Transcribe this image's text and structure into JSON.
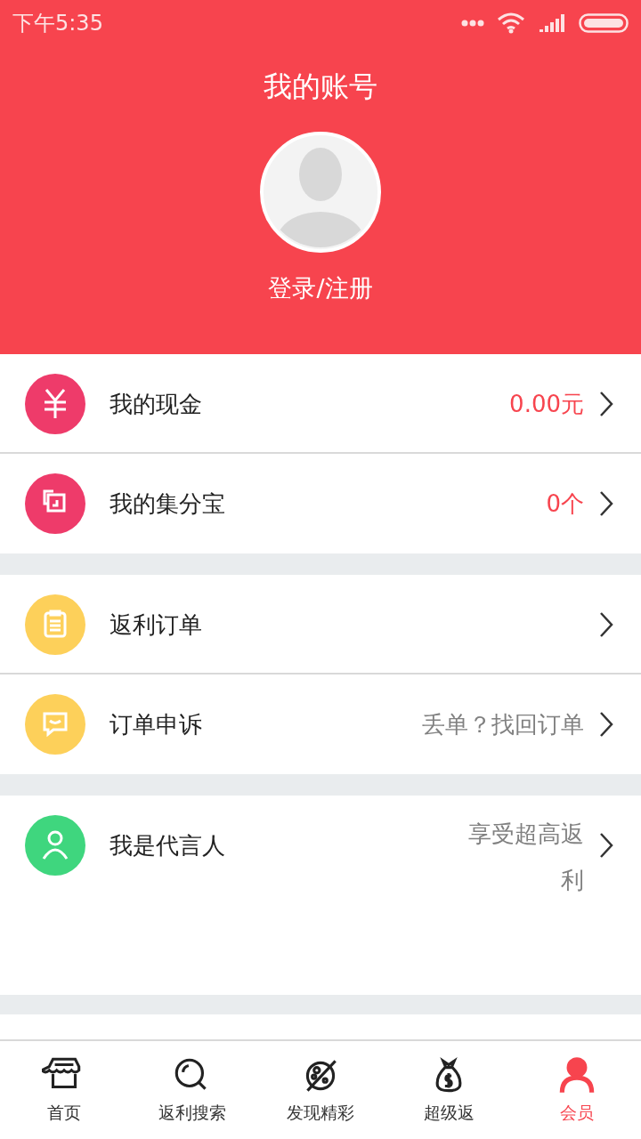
{
  "status_bar": {
    "time": "下午5:35"
  },
  "header": {
    "title": "我的账号",
    "login": "登录/注册"
  },
  "sections": [
    {
      "rows": [
        {
          "kind": "cash",
          "color": "#ee3b6a",
          "label": "我的现金",
          "detail": "0.00元",
          "accent": true
        },
        {
          "kind": "points",
          "color": "#ee3b6a",
          "label": "我的集分宝",
          "detail": "0个",
          "accent": true
        }
      ]
    },
    {
      "rows": [
        {
          "kind": "orders",
          "color": "#fdd05a",
          "label": "返利订单"
        },
        {
          "kind": "appeal",
          "color": "#fdd05a",
          "label": "订单申诉",
          "detail": "丢单？找回订单",
          "accent": false
        }
      ]
    },
    {
      "rows": [
        {
          "kind": "spokesperson",
          "color": "#3fd67e",
          "label": "我是代言人",
          "detail": "享受超高返利",
          "accent": false,
          "tall": true
        }
      ]
    }
  ],
  "tabs": [
    {
      "kind": "home",
      "label": "首页",
      "selected": false
    },
    {
      "kind": "search",
      "label": "返利搜索",
      "selected": false
    },
    {
      "kind": "discover",
      "label": "发现精彩",
      "selected": false
    },
    {
      "kind": "money",
      "label": "超级返",
      "selected": false
    },
    {
      "kind": "member",
      "label": "会员",
      "selected": true
    }
  ]
}
